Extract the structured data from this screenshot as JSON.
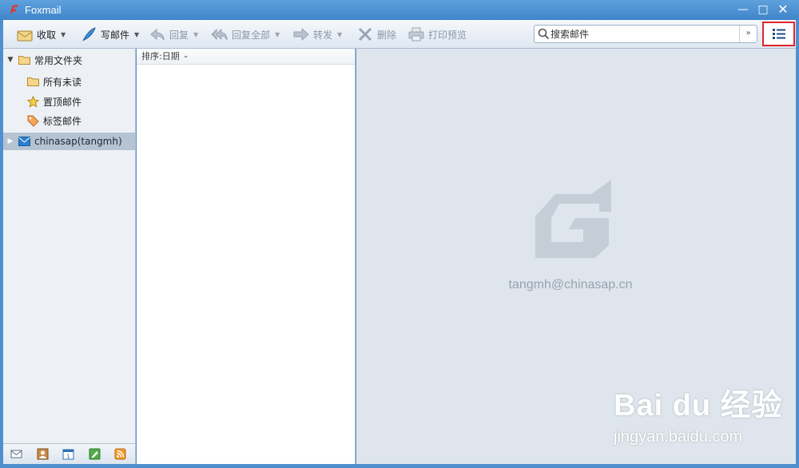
{
  "window": {
    "title": "Foxmail"
  },
  "toolbar": {
    "receive": "收取",
    "compose": "写邮件",
    "reply": "回复",
    "reply_all": "回复全部",
    "forward": "转发",
    "delete": "删除",
    "print_preview": "打印预览"
  },
  "search": {
    "placeholder": "搜索邮件"
  },
  "sidebar": {
    "common_folders": "常用文件夹",
    "items": [
      {
        "label": "所有未读"
      },
      {
        "label": "置顶邮件"
      },
      {
        "label": "标签邮件"
      }
    ],
    "account": "chinasap(tangmh)"
  },
  "maillist": {
    "sort_label": "排序:日期"
  },
  "reading": {
    "email": "tangmh@chinasap.cn"
  },
  "watermark": {
    "brand": "Bai du 经验",
    "url": "jingyan.baidu.com"
  },
  "colors": {
    "accent": "#3f84c9",
    "highlight": "#e0242a"
  }
}
